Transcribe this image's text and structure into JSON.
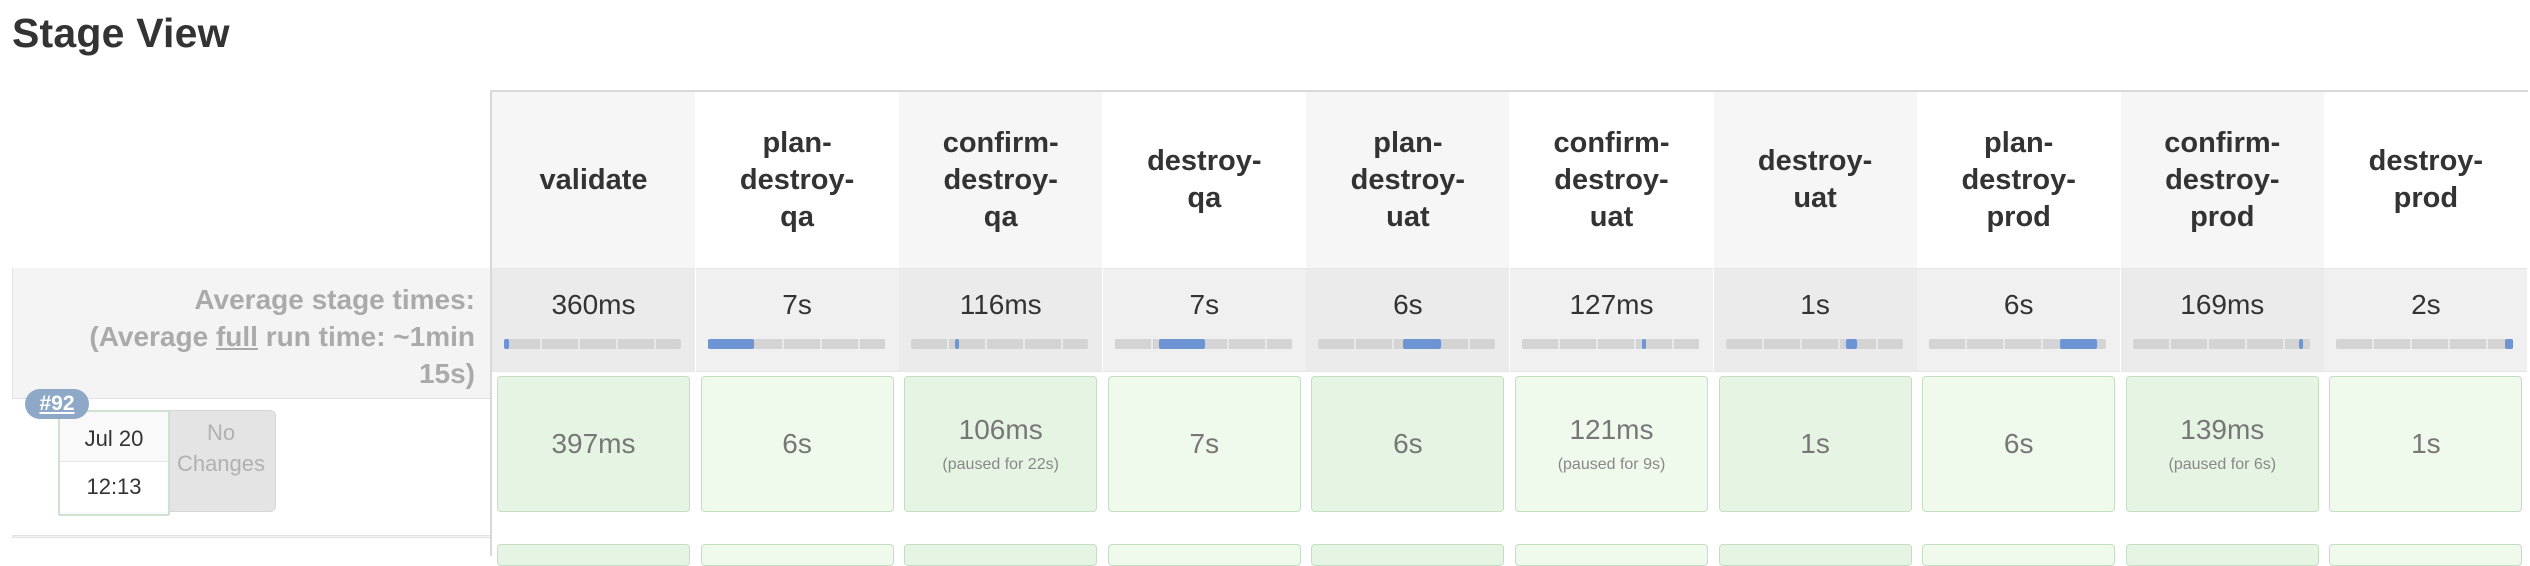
{
  "page": {
    "title": "Stage View"
  },
  "summary": {
    "avg_line1": "Average stage times:",
    "avg_line2_pre": "(Average ",
    "avg_line2_link": "full",
    "avg_line2_post": " run time: ~1min",
    "avg_line3": "15s)"
  },
  "build": {
    "number": "#92",
    "date": "Jul 20",
    "time": "12:13",
    "changes_line1": "No",
    "changes_line2": "Changes"
  },
  "stages": [
    {
      "name": "validate",
      "avg": "360ms",
      "avg_progress": 0.03,
      "bar_start": 0.0,
      "run": "397ms",
      "paused": ""
    },
    {
      "name": "plan-destroy-qa",
      "avg": "7s",
      "avg_progress": 0.26,
      "bar_start": 0.0,
      "run": "6s",
      "paused": ""
    },
    {
      "name": "confirm-destroy-qa",
      "avg": "116ms",
      "avg_progress": 0.02,
      "bar_start": 0.25,
      "run": "106ms",
      "paused": "(paused for 22s)"
    },
    {
      "name": "destroy-qa",
      "avg": "7s",
      "avg_progress": 0.26,
      "bar_start": 0.25,
      "run": "7s",
      "paused": ""
    },
    {
      "name": "plan-destroy-uat",
      "avg": "6s",
      "avg_progress": 0.21,
      "bar_start": 0.48,
      "run": "6s",
      "paused": ""
    },
    {
      "name": "confirm-destroy-uat",
      "avg": "127ms",
      "avg_progress": 0.02,
      "bar_start": 0.68,
      "run": "121ms",
      "paused": "(paused for 9s)"
    },
    {
      "name": "destroy-uat",
      "avg": "1s",
      "avg_progress": 0.06,
      "bar_start": 0.68,
      "run": "1s",
      "paused": ""
    },
    {
      "name": "plan-destroy-prod",
      "avg": "6s",
      "avg_progress": 0.21,
      "bar_start": 0.74,
      "run": "6s",
      "paused": ""
    },
    {
      "name": "confirm-destroy-prod",
      "avg": "169ms",
      "avg_progress": 0.02,
      "bar_start": 0.94,
      "run": "139ms",
      "paused": "(paused for 6s)"
    },
    {
      "name": "destroy-prod",
      "avg": "2s",
      "avg_progress": 0.05,
      "bar_start": 0.95,
      "run": "1s",
      "paused": ""
    }
  ],
  "colors": {
    "success_cell": "#e6f5e3",
    "bar_fill": "#6d95d3",
    "badge": "#8ea9c8"
  }
}
